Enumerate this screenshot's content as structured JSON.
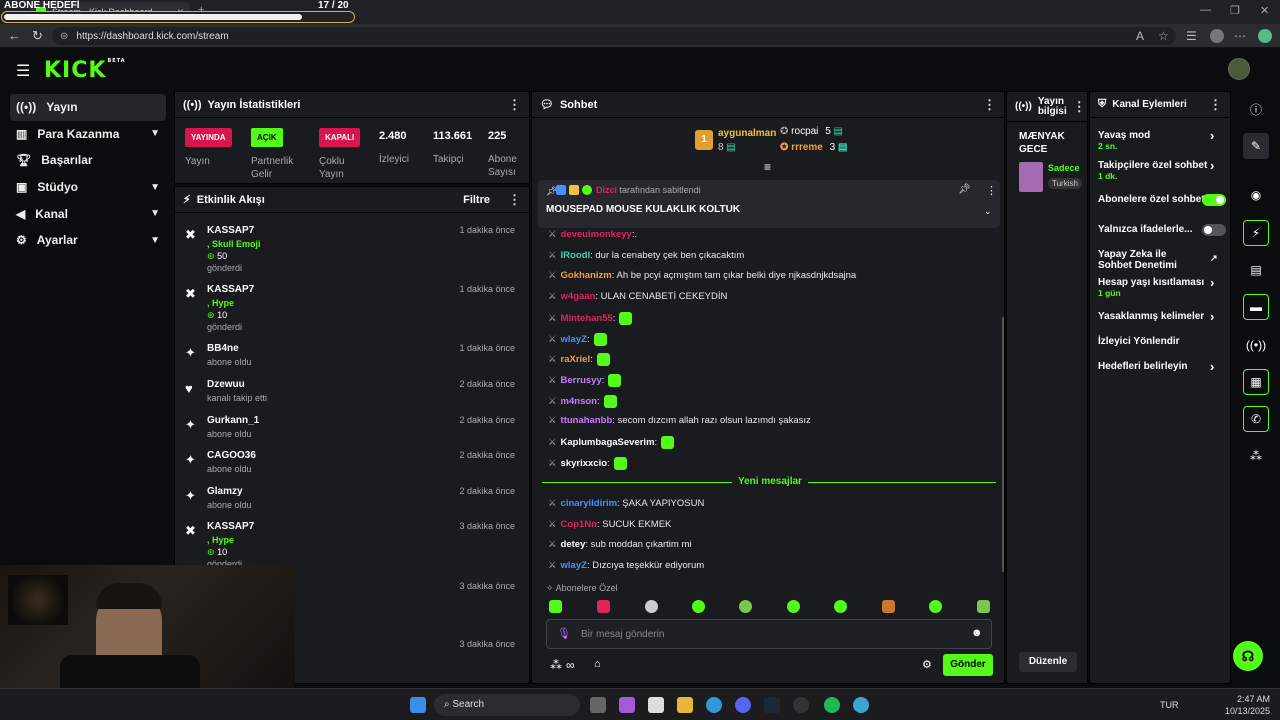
{
  "goal_overlay": {
    "label": "ABONE HEDEFİ",
    "count": "17 / 20",
    "progress": 0.85
  },
  "browser": {
    "tab_title": "Stream - Kick Dashboard",
    "url": "https://dashboard.kick.com/stream"
  },
  "brand": {
    "logo": "KICK",
    "beta": "BETA"
  },
  "sidebar": {
    "items": [
      {
        "label": "Yayın",
        "icon": "broadcast-icon"
      },
      {
        "label": "Para Kazanma",
        "icon": "money-icon"
      },
      {
        "label": "Başarılar",
        "icon": "trophy-icon"
      },
      {
        "label": "Stüdyo",
        "icon": "studio-icon"
      },
      {
        "label": "Kanal",
        "icon": "channel-icon"
      },
      {
        "label": "Ayarlar",
        "icon": "settings-icon"
      }
    ]
  },
  "stats": {
    "title": "Yayın İstatistikleri",
    "live_badge": "YAYINDA",
    "live_label": "Yayın",
    "partner_badge": "AÇIK",
    "partner_label": "Partnerlik Gelir",
    "multi_badge": "KAPALI",
    "multi_label": "Çoklu Yayın",
    "viewers": "2.480",
    "viewers_label": "İzleyici",
    "followers": "113.661",
    "followers_label": "Takipçi",
    "subs": "225",
    "subs_label": "Abone Sayısı"
  },
  "activity": {
    "title": "Etkinlik Akışı",
    "filter": "Filtre",
    "items": [
      {
        "name": "KASSAP7",
        "line1": ", Skull Emoji",
        "amount": "50",
        "line2": "gönderdi",
        "time": "1 dakika önce"
      },
      {
        "name": "KASSAP7",
        "line1": ", Hype",
        "amount": "10",
        "line2": "gönderdi",
        "time": "1 dakika önce"
      },
      {
        "name": "BB4ne",
        "line1": "abone oldu",
        "time": "1 dakika önce"
      },
      {
        "name": "Dzewuu",
        "line1": "kanalı takip etti",
        "time": "2 dakika önce"
      },
      {
        "name": "Gurkann_1",
        "line1": "abone oldu",
        "time": "2 dakika önce"
      },
      {
        "name": "CAGOO36",
        "line1": "abone oldu",
        "time": "2 dakika önce"
      },
      {
        "name": "Glamzy",
        "line1": "abone oldu",
        "time": "2 dakika önce"
      },
      {
        "name": "KASSAP7",
        "line1": ", Hype",
        "amount": "10",
        "line2": "gönderdi",
        "time": "3 dakika önce"
      },
      {
        "time": "3 dakika önce"
      },
      {
        "time": "3 dakika önce"
      }
    ]
  },
  "chat": {
    "title": "Sohbet",
    "top": [
      {
        "name": "aygunalman",
        "count": "8",
        "rank": "1"
      },
      {
        "name": "rocpai",
        "count": "5"
      },
      {
        "name": "rrreme",
        "count": "3"
      }
    ],
    "pinned_by_name": "Dizci",
    "pinned_by_text": "tarafından sabitlendi",
    "pinned_message": "MOUSEPAD MOUSE KULAKLIK KOLTUK",
    "messages": [
      {
        "user": "deveuimonkeyy",
        "text": ":.",
        "color": "#e0245e"
      },
      {
        "user": "IRoodI",
        "text": ": dur la cenabety çek ben çıkacaktım",
        "color": "#3ad4b0"
      },
      {
        "user": "Gokhanizm",
        "text": ": Ah be pcyi açmıştım tam çıkar belki diye njkasdnjkdsajna",
        "color": "#f59e42"
      },
      {
        "user": "w4gaan",
        "text": ": ULAN CENABETİ CEKEYDİN",
        "color": "#e0245e"
      },
      {
        "user": "Mintehan55",
        "text": ":",
        "color": "#e0245e"
      },
      {
        "user": "wlayZ",
        "text": ":",
        "color": "#4a90ff"
      },
      {
        "user": "raXriel",
        "text": ":",
        "color": "#f59e42"
      },
      {
        "user": "Berrusyy",
        "text": ":",
        "color": "#c77dff"
      },
      {
        "user": "m4nson",
        "text": ":",
        "color": "#c77dff"
      },
      {
        "user": "ttunahanbb",
        "text": ": secom dızcım allah razı olsun lazımdı şakasız",
        "color": "#c77dff"
      },
      {
        "user": "KaplumbagaSeverim",
        "text": ":",
        "color": "#ffffff"
      },
      {
        "user": "skyrixxcio",
        "text": ":",
        "color": "#ffffff"
      }
    ],
    "new_messages_label": "Yeni mesajlar",
    "new_messages": [
      {
        "user": "cinaryildirim",
        "text": ": ŞAKA YAPIYOSUN",
        "color": "#4a90ff"
      },
      {
        "user": "Cop1Nn",
        "text": ": SUCUK EKMEK",
        "color": "#e0245e"
      },
      {
        "user": "detey",
        "text": ": sub moddan çıkartim mi",
        "color": "#ffffff"
      },
      {
        "user": "wlayZ",
        "text": ": Dızcıya teşekkür ediyorum",
        "color": "#4a90ff"
      }
    ],
    "sub_emotes_label": "Abonelere Özel",
    "input_placeholder": "Bir mesaj gönderin",
    "send_label": "Gönder"
  },
  "stream_info": {
    "title": "Yayın bilgisi",
    "stream_title": "MÆNYAK GECE",
    "category": "Sadece",
    "tag": "Turkish",
    "edit_label": "Düzenle"
  },
  "channel_actions": {
    "title": "Kanal Eylemleri",
    "items": [
      {
        "label": "Yavaş mod",
        "sub": "2 sn."
      },
      {
        "label": "Takipçilere özel sohbet",
        "sub": "1 dk."
      },
      {
        "label": "Abonelere özel sohbet",
        "toggle": "on"
      },
      {
        "label": "Yalnızca ifadelerle...",
        "toggle": "off"
      },
      {
        "label": "Yapay Zeka ile Sohbet Denetimi"
      },
      {
        "label": "Hesap yaşı kısıtlaması",
        "sub": "1 gün"
      },
      {
        "label": "Yasaklanmış kelimeler"
      },
      {
        "label": "İzleyici Yönlendir"
      },
      {
        "label": "Hedefleri belirleyin"
      }
    ]
  },
  "taskbar": {
    "search": "Search",
    "lang": "TUR",
    "time": "2:47 AM",
    "date": "10/13/2025"
  },
  "colors": {
    "accent": "#53fc18",
    "live": "#d6164d",
    "panel": "#191b1f",
    "bg": "#0b0c0d"
  }
}
